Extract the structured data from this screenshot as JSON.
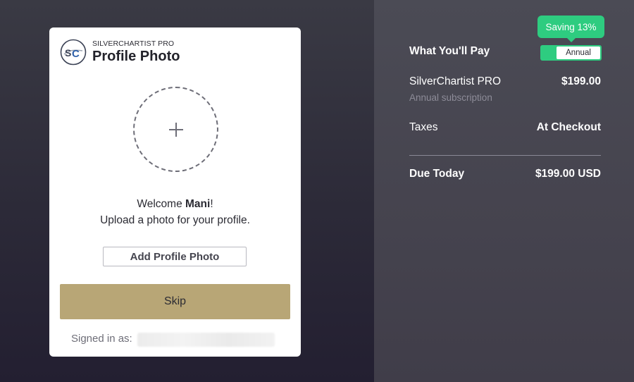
{
  "card": {
    "brand": "SILVERCHARTIST PRO",
    "title": "Profile Photo",
    "welcome_prefix": "Welcome ",
    "user_name": "Mani",
    "welcome_suffix": "!",
    "upload_prompt": "Upload a photo for your profile.",
    "add_photo_label": "Add Profile Photo",
    "skip_label": "Skip",
    "signed_in_label": "Signed in as:"
  },
  "summary": {
    "title": "What You'll Pay",
    "saving_badge": "Saving 13%",
    "billing_toggle_selected": "Annual",
    "product_name": "SilverChartist PRO",
    "product_price": "$199.00",
    "product_sub": "Annual subscription",
    "taxes_label": "Taxes",
    "taxes_value": "At Checkout",
    "due_label": "Due Today",
    "due_value": "$199.00 USD"
  },
  "colors": {
    "accent_gold": "#b8a676",
    "accent_green": "#2ecc80",
    "logo_blue": "#2d5fa8"
  },
  "icons": {
    "logo": "silverchartist-logo",
    "add_photo": "plus-icon"
  }
}
